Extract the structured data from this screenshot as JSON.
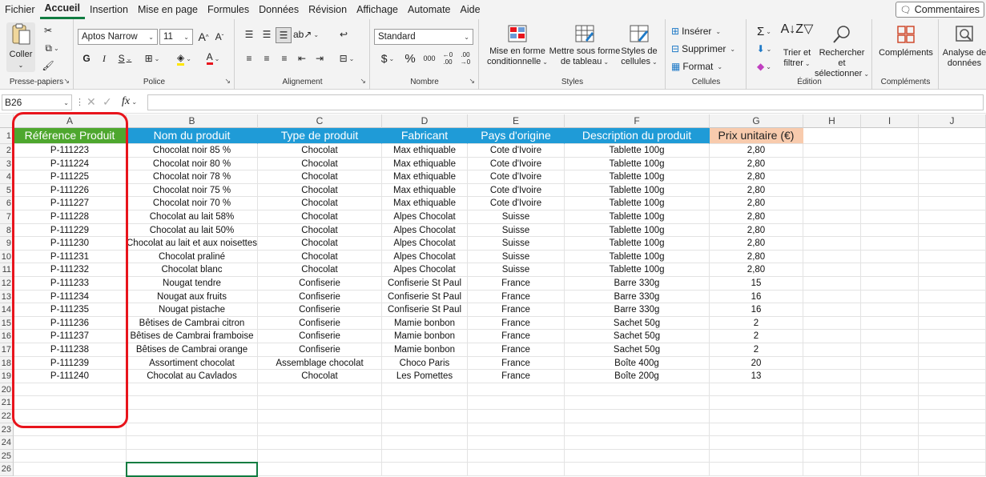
{
  "menu": {
    "items": [
      "Fichier",
      "Accueil",
      "Insertion",
      "Mise en page",
      "Formules",
      "Données",
      "Révision",
      "Affichage",
      "Automate",
      "Aide"
    ],
    "active_index": 1,
    "comments_label": "Commentaires"
  },
  "ribbon": {
    "clipboard": {
      "paste_label": "Coller",
      "group_label": "Presse-papiers"
    },
    "font": {
      "font_name": "Aptos Narrow",
      "font_size": "11",
      "group_label": "Police",
      "bold": "G",
      "italic": "I",
      "underline": "S",
      "grow": "A",
      "shrink": "A"
    },
    "alignment": {
      "group_label": "Alignement"
    },
    "number": {
      "format": "Standard",
      "group_label": "Nombre",
      "currency": "$",
      "percent": "%",
      "thousands": "000",
      "inc_decimal": "←0 .00",
      "dec_decimal": ".00 →0"
    },
    "styles": {
      "conditional_label": "Mise en forme conditionnelle",
      "table_label": "Mettre sous forme de tableau",
      "cell_styles_label": "Styles de cellules",
      "group_label": "Styles"
    },
    "cells": {
      "insert_label": "Insérer",
      "delete_label": "Supprimer",
      "format_label": "Format",
      "group_label": "Cellules"
    },
    "editing": {
      "sort_label": "Trier et filtrer",
      "find_label": "Rechercher et sélectionner",
      "group_label": "Édition"
    },
    "addins": {
      "addins_label": "Compléments",
      "group_label": "Compléments"
    },
    "analyze": {
      "label": "Analyse de données"
    }
  },
  "formula_bar": {
    "name_box": "B26",
    "fx": "fx",
    "value": ""
  },
  "sheet": {
    "columns": [
      "A",
      "B",
      "C",
      "D",
      "E",
      "F",
      "G",
      "H",
      "I",
      "J"
    ],
    "headers": [
      "Référence Produit",
      "Nom du produit",
      "Type de produit",
      "Fabricant",
      "Pays d'origine",
      "Description du produit",
      "Prix unitaire (€)"
    ],
    "header_colors": [
      "#4ea72e",
      "#1f9bd7",
      "#1f9bd7",
      "#1f9bd7",
      "#1f9bd7",
      "#1f9bd7",
      "#f8cbad"
    ],
    "header_text_colors": [
      "#ffffff",
      "#ffffff",
      "#ffffff",
      "#ffffff",
      "#ffffff",
      "#ffffff",
      "#222222"
    ],
    "row_numbers": [
      "1",
      "2",
      "3",
      "4",
      "5",
      "6",
      "7",
      "8",
      "9",
      "10",
      "11",
      "12",
      "13",
      "14",
      "15",
      "16",
      "17",
      "18",
      "19",
      "20",
      "21",
      "22",
      "23",
      "24",
      "25",
      "26"
    ],
    "rows": [
      [
        "P-111223",
        "Chocolat noir 85 %",
        "Chocolat",
        "Max ethiquable",
        "Cote d'Ivoire",
        "Tablette 100g",
        "2,80"
      ],
      [
        "P-111224",
        "Chocolat noir 80 %",
        "Chocolat",
        "Max ethiquable",
        "Cote d'Ivoire",
        "Tablette 100g",
        "2,80"
      ],
      [
        "P-111225",
        "Chocolat noir 78 %",
        "Chocolat",
        "Max ethiquable",
        "Cote d'Ivoire",
        "Tablette 100g",
        "2,80"
      ],
      [
        "P-111226",
        "Chocolat noir 75 %",
        "Chocolat",
        "Max ethiquable",
        "Cote d'Ivoire",
        "Tablette 100g",
        "2,80"
      ],
      [
        "P-111227",
        "Chocolat noir 70 %",
        "Chocolat",
        "Max ethiquable",
        "Cote d'Ivoire",
        "Tablette 100g",
        "2,80"
      ],
      [
        "P-111228",
        "Chocolat au lait 58%",
        "Chocolat",
        "Alpes Chocolat",
        "Suisse",
        "Tablette 100g",
        "2,80"
      ],
      [
        "P-111229",
        "Chocolat au lait 50%",
        "Chocolat",
        "Alpes Chocolat",
        "Suisse",
        "Tablette 100g",
        "2,80"
      ],
      [
        "P-111230",
        "Chocolat au lait et aux noisettes",
        "Chocolat",
        "Alpes Chocolat",
        "Suisse",
        "Tablette 100g",
        "2,80"
      ],
      [
        "P-111231",
        "Chocolat praliné",
        "Chocolat",
        "Alpes Chocolat",
        "Suisse",
        "Tablette 100g",
        "2,80"
      ],
      [
        "P-111232",
        "Chocolat blanc",
        "Chocolat",
        "Alpes Chocolat",
        "Suisse",
        "Tablette 100g",
        "2,80"
      ],
      [
        "P-111233",
        "Nougat tendre",
        "Confiserie",
        "Confiserie St Paul",
        "France",
        "Barre 330g",
        "15"
      ],
      [
        "P-111234",
        "Nougat aux fruits",
        "Confiserie",
        "Confiserie St Paul",
        "France",
        "Barre 330g",
        "16"
      ],
      [
        "P-111235",
        "Nougat pistache",
        "Confiserie",
        "Confiserie St Paul",
        "France",
        "Barre 330g",
        "16"
      ],
      [
        "P-111236",
        "Bêtises de Cambrai citron",
        "Confiserie",
        "Mamie bonbon",
        "France",
        "Sachet 50g",
        "2"
      ],
      [
        "P-111237",
        "Bêtises de Cambrai framboise",
        "Confiserie",
        "Mamie bonbon",
        "France",
        "Sachet 50g",
        "2"
      ],
      [
        "P-111238",
        "Bêtises de Cambrai orange",
        "Confiserie",
        "Mamie bonbon",
        "France",
        "Sachet 50g",
        "2"
      ],
      [
        "P-111239",
        "Assortiment chocolat",
        "Assemblage chocolat",
        "Choco Paris",
        "France",
        "Boîte 400g",
        "20"
      ],
      [
        "P-111240",
        "Chocolat au Cavlados",
        "Chocolat",
        "Les Pomettes",
        "France",
        "Boîte 200g",
        "13"
      ]
    ],
    "highlight_color": "#e8141c",
    "selection_color": "#107c41"
  }
}
